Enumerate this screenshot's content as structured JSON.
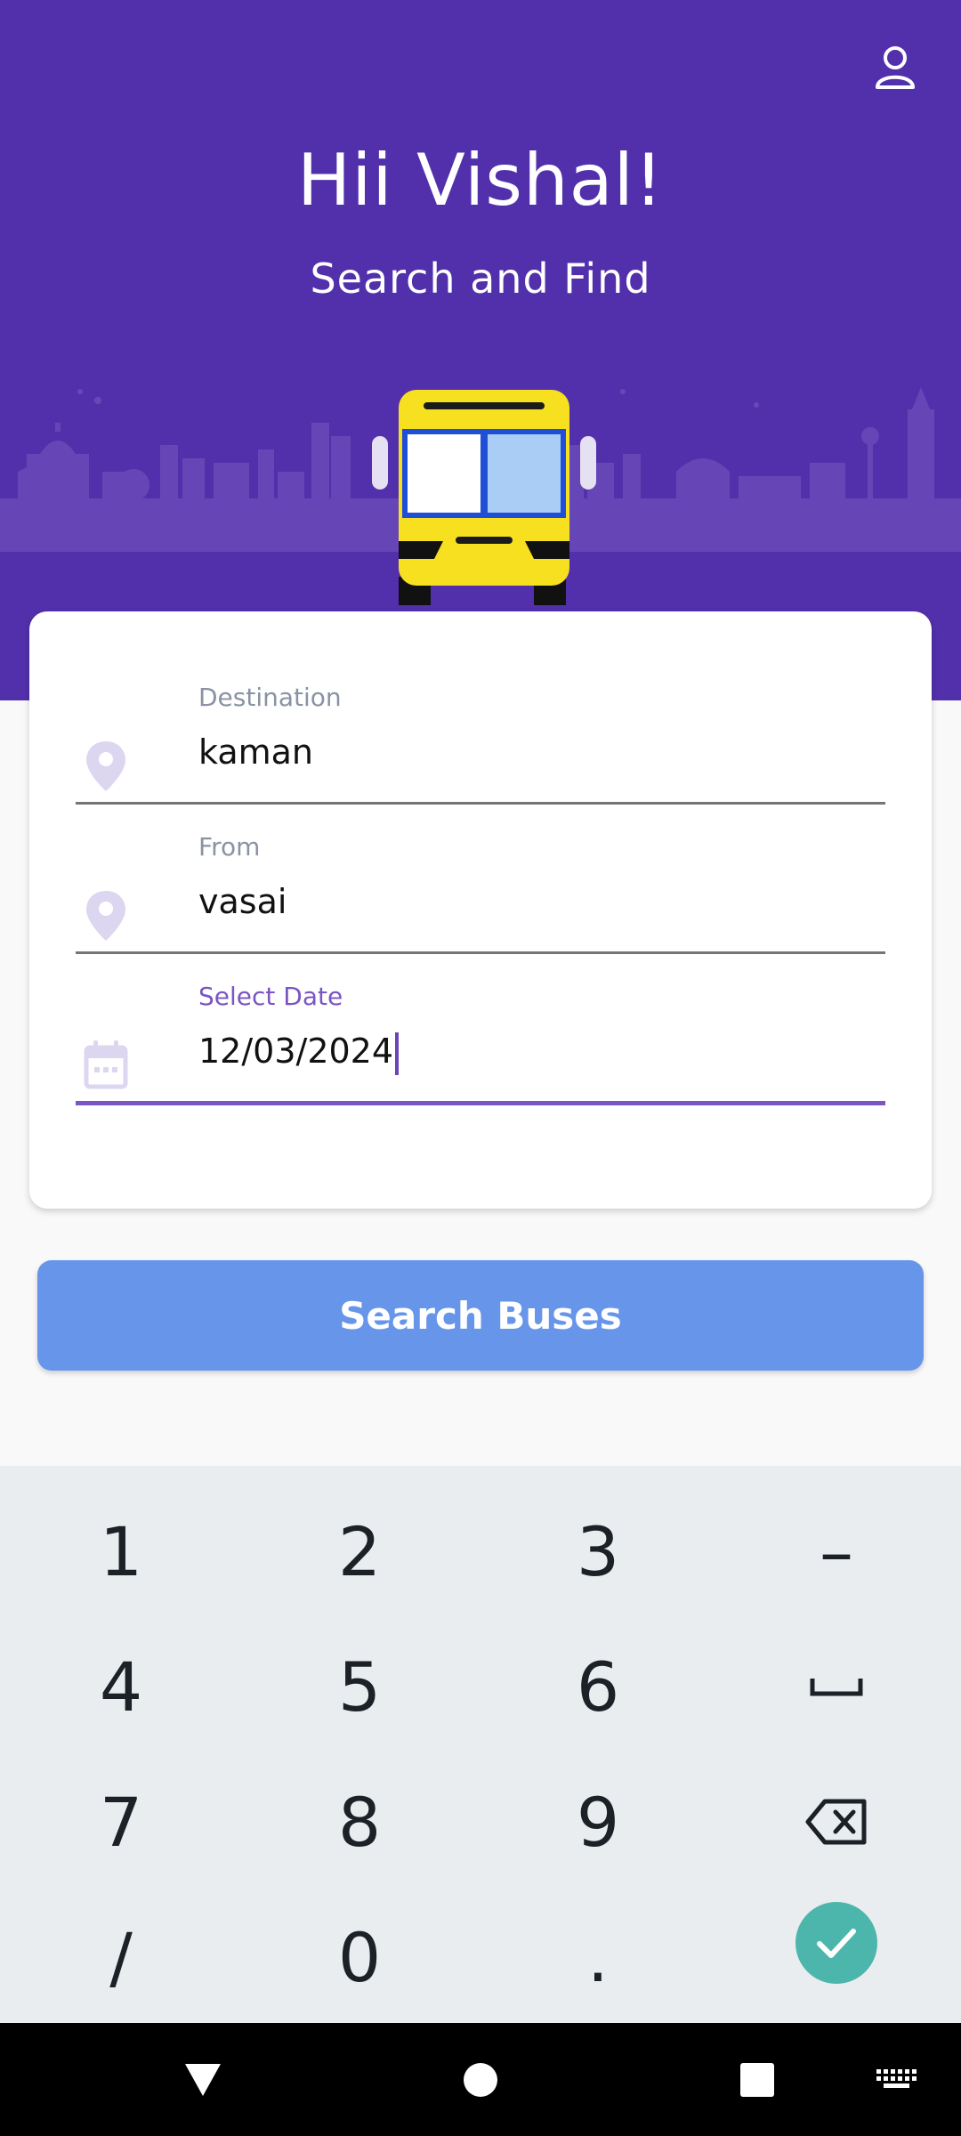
{
  "header": {
    "greeting": "Hii Vishal!",
    "subtitle": "Search and Find",
    "profile_icon": "person-outline-icon",
    "background_color": "#5230ab",
    "bus_icon": "bus-front-icon"
  },
  "form": {
    "destination": {
      "label": "Destination",
      "value": "kaman",
      "icon": "location-pin-icon"
    },
    "from": {
      "label": "From",
      "value": "vasai",
      "icon": "location-pin-icon"
    },
    "date": {
      "label": "Select Date",
      "value": "12/03/2024",
      "icon": "calendar-icon"
    }
  },
  "search_button": {
    "label": "Search Buses",
    "color": "#6695ea"
  },
  "keypad": {
    "keys": [
      "1",
      "2",
      "3",
      "–",
      "4",
      "5",
      "6",
      "␣",
      "7",
      "8",
      "9",
      "⌫",
      "/",
      "0",
      ".",
      "✓"
    ],
    "accent_color": "#4db6ac"
  },
  "navbar": {
    "back": "back-triangle-icon",
    "home": "home-circle-icon",
    "recents": "recents-square-icon",
    "keyboard": "keyboard-icon"
  }
}
